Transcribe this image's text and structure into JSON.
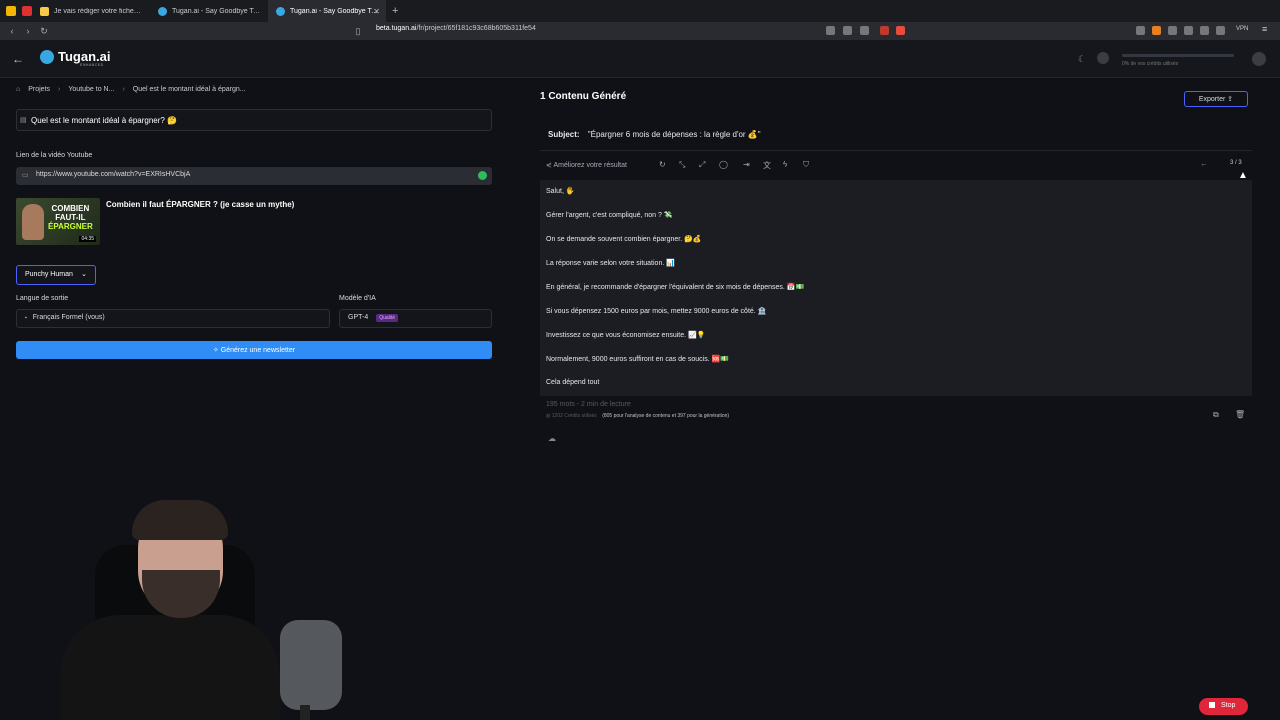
{
  "browser": {
    "tabs": [
      {
        "title": "Je vais rédiger votre fiche produit",
        "active": false
      },
      {
        "title": "Tugan.ai - Say Goodbye To Your C",
        "active": false
      },
      {
        "title": "Tugan.ai - Say Goodbye To Yo",
        "active": true
      }
    ],
    "url_host": "beta.tugan.ai",
    "url_path": "/fr/project/65f181c93c68b605b311fe54",
    "vpn_label": "VPN"
  },
  "app": {
    "logo": "Tugan.ai",
    "logo_sub": "ENHANCED",
    "credits_label": "0% de vos crédits utilisés"
  },
  "breadcrumb": {
    "items": [
      "Projets",
      "Youtube to N...",
      "Quel est le montant idéal à épargn..."
    ]
  },
  "left": {
    "title_input": "Quel est le montant idéal à épargner? 🤔",
    "video_link_label": "Lien de la vidéo Youtube",
    "video_link": "https://www.youtube.com/watch?v=EXRIsHVCbjA",
    "video_title": "Combien il faut ÉPARGNER ? (je casse un mythe)",
    "thumb_text_1": "COMBIEN",
    "thumb_text_2": "FAUT-IL",
    "thumb_text_3": "ÉPARGNER",
    "thumb_duration": "04:35",
    "style_selected": "Punchy Human",
    "language_label": "Langue de sortie",
    "language_value": "Français Formel (vous)",
    "model_label": "Modèle d'IA",
    "model_value": "GPT-4",
    "model_badge": "Qualité",
    "generate_button": "Générez une newsletter"
  },
  "right": {
    "heading": "1 Contenu Généré",
    "export_button": "Exporter",
    "subject_label": "Subject:",
    "subject_value": "\"Épargner 6 mois de dépenses : la règle d'or 💰\"",
    "improve_label": "Améliorez votre résultat",
    "pager": "3 / 3",
    "paragraphs": [
      "Salut, 🖐️",
      "Gérer l'argent, c'est compliqué, non ? 💸",
      "On se demande souvent combien épargner. 🤔💰",
      "La réponse varie selon votre situation. 📊",
      "En général, je recommande d'épargner l'équivalent de six mois de dépenses. 📅💵",
      "Si vous dépensez 1500 euros par mois, mettez 9000 euros de côté. 🏦",
      "Investissez ce que vous économisez ensuite. 📈💡",
      "Normalement, 9000 euros suffiront en cas de soucis. 🆘💵",
      "Cela dépend tout"
    ],
    "stats": "195 mots - 2 min de lecture",
    "credits_used": "1202 Crédits utilisés",
    "credits_detail": "(805 pour l'analyse de contenu et 397 pour la génération)"
  },
  "stop_button": "Stop"
}
